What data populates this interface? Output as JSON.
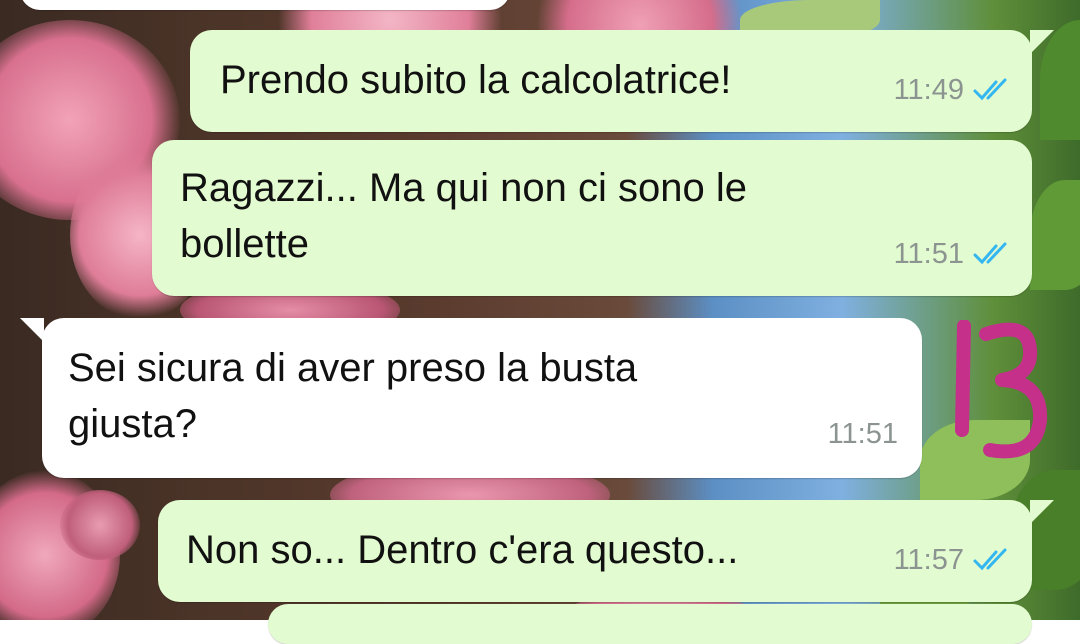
{
  "chat": {
    "messages": [
      {
        "direction": "outgoing",
        "text": "Prendo subito la calcolatrice!",
        "time": "11:49",
        "status_icon": "double-check-icon"
      },
      {
        "direction": "outgoing",
        "text_lines": [
          "Ragazzi... Ma qui non ci sono le",
          "bollette"
        ],
        "time": "11:51",
        "status_icon": "double-check-icon"
      },
      {
        "direction": "incoming",
        "text_lines": [
          "Sei sicura di aver preso la busta",
          "giusta?"
        ],
        "time": "11:51"
      },
      {
        "direction": "outgoing",
        "text": "Non so... Dentro c'era questo...",
        "time": "11:57",
        "status_icon": "double-check-icon"
      }
    ]
  },
  "overlay": {
    "page_number": "13",
    "page_number_color": "#c4308a"
  },
  "colors": {
    "outgoing_bubble": "#e3fbd0",
    "incoming_bubble": "#ffffff",
    "read_ticks": "#34b7f1",
    "time_text": "#8b9490"
  }
}
